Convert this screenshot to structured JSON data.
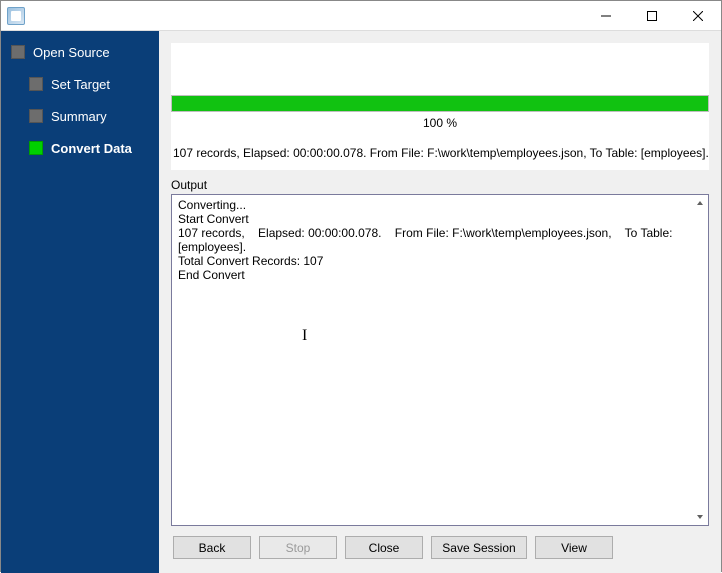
{
  "window": {
    "title": ""
  },
  "sidebar": {
    "items": [
      {
        "label": "Open Source",
        "active": false,
        "level": 0
      },
      {
        "label": "Set Target",
        "active": false,
        "level": 1
      },
      {
        "label": "Summary",
        "active": false,
        "level": 1
      },
      {
        "label": "Convert Data",
        "active": true,
        "level": 1
      }
    ]
  },
  "progress": {
    "percent_value": 100,
    "percent_label": "100 %",
    "status_line": "107 records,    Elapsed: 00:00:00.078.    From File: F:\\work\\temp\\employees.json,    To Table: [employees]."
  },
  "output": {
    "label": "Output",
    "text": "Converting...\nStart Convert\n107 records,    Elapsed: 00:00:00.078.    From File: F:\\work\\temp\\employees.json,    To Table: [employees].\nTotal Convert Records: 107\nEnd Convert"
  },
  "buttons": {
    "back": "Back",
    "stop": "Stop",
    "close": "Close",
    "save_session": "Save Session",
    "view": "View",
    "stop_disabled": true
  }
}
